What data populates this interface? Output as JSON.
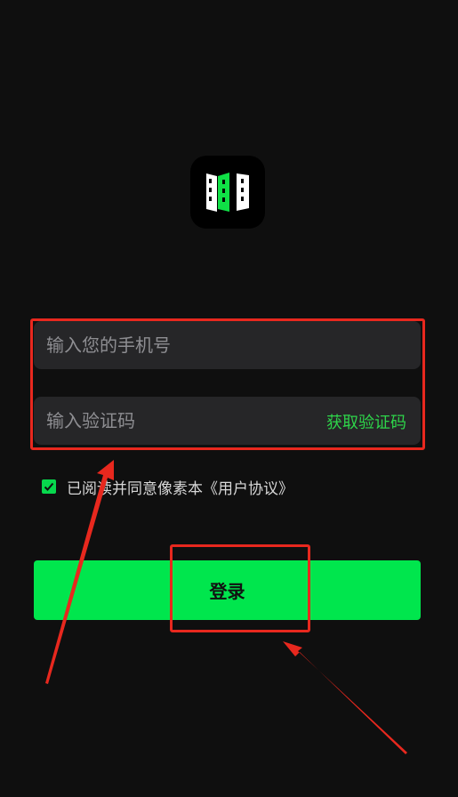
{
  "app": {
    "logo_icon": "film-strip-logo-icon",
    "accent_color": "#00e64d"
  },
  "login_form": {
    "phone_placeholder": "输入您的手机号",
    "code_placeholder": "输入验证码",
    "get_code_label": "获取验证码",
    "agreement_prefix": "已阅读并同意像素本",
    "agreement_link": "《用户协议》",
    "agreement_checked": true,
    "login_label": "登录"
  },
  "annotations": {
    "highlight_color": "#e8281e"
  }
}
